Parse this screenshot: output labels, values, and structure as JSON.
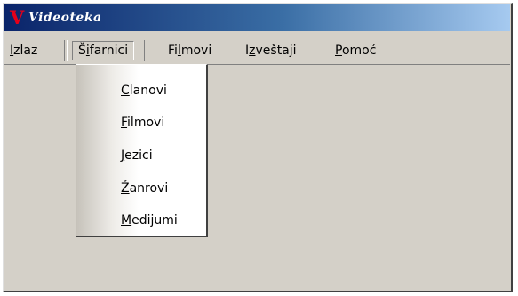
{
  "window": {
    "title": "Videoteka",
    "icon_glyph": "V",
    "icon_name": "app-icon",
    "title_color_start": "#0a246a",
    "title_color_end": "#a6caf0",
    "icon_color": "#e4001a"
  },
  "menu": [
    {
      "pre": "",
      "u": "I",
      "post": "zlaz"
    },
    {
      "pre": "Š",
      "u": "i",
      "post": "farnici"
    },
    {
      "pre": "Fi",
      "u": "l",
      "post": "movi"
    },
    {
      "pre": "I",
      "u": "z",
      "post": "veštaji"
    },
    {
      "pre": "",
      "u": "P",
      "post": "omoć"
    }
  ],
  "dropdown": [
    {
      "pre": "",
      "u": "C",
      "post": "lanovi"
    },
    {
      "pre": "",
      "u": "F",
      "post": "ilmovi"
    },
    {
      "pre": "",
      "u": "J",
      "post": "ezici"
    },
    {
      "pre": "",
      "u": "Ž",
      "post": "anrovi"
    },
    {
      "pre": "",
      "u": "M",
      "post": "edijumi"
    }
  ]
}
